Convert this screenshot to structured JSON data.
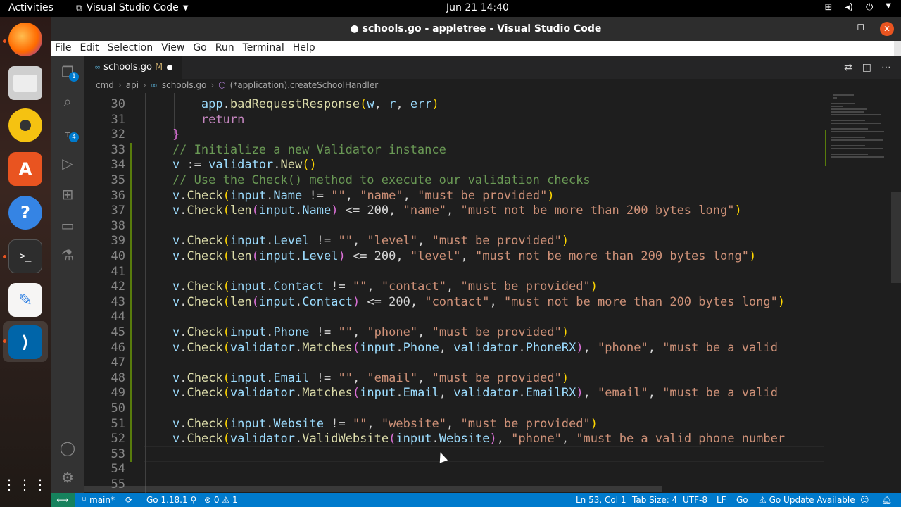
{
  "topbar": {
    "activities": "Activities",
    "app_menu": "Visual Studio Code",
    "clock": "Jun 21  14:40"
  },
  "dock": {
    "items": [
      "firefox-icon",
      "files-icon",
      "rhythmbox-icon",
      "software-icon",
      "help-icon",
      "terminal-icon",
      "text-editor-icon",
      "vscode-icon",
      "show-apps-icon"
    ]
  },
  "window": {
    "title": "● schools.go - appletree - Visual Studio Code"
  },
  "menu": [
    "File",
    "Edit",
    "Selection",
    "View",
    "Go",
    "Run",
    "Terminal",
    "Help"
  ],
  "activitybar": {
    "explorer_badge": "1",
    "scm_badge": "4"
  },
  "tab": {
    "label": "schools.go",
    "modified": "M"
  },
  "breadcrumb": [
    "cmd",
    "api",
    "schools.go",
    "(*application).createSchoolHandler"
  ],
  "editor": {
    "lines": [
      {
        "n": "30",
        "code": "        app.badRequestResponse(w, r, err)"
      },
      {
        "n": "31",
        "code": "        return"
      },
      {
        "n": "32",
        "code": "    }"
      },
      {
        "n": "33",
        "code": "    // Initialize a new Validator instance"
      },
      {
        "n": "34",
        "code": "    v := validator.New()"
      },
      {
        "n": "35",
        "code": "    // Use the Check() method to execute our validation checks"
      },
      {
        "n": "36",
        "code": "    v.Check(input.Name != \"\", \"name\", \"must be provided\")"
      },
      {
        "n": "37",
        "code": "    v.Check(len(input.Name) <= 200, \"name\", \"must not be more than 200 bytes long\")"
      },
      {
        "n": "38",
        "code": ""
      },
      {
        "n": "39",
        "code": "    v.Check(input.Level != \"\", \"level\", \"must be provided\")"
      },
      {
        "n": "40",
        "code": "    v.Check(len(input.Level) <= 200, \"level\", \"must not be more than 200 bytes long\")"
      },
      {
        "n": "41",
        "code": ""
      },
      {
        "n": "42",
        "code": "    v.Check(input.Contact != \"\", \"contact\", \"must be provided\")"
      },
      {
        "n": "43",
        "code": "    v.Check(len(input.Contact) <= 200, \"contact\", \"must not be more than 200 bytes long\")"
      },
      {
        "n": "44",
        "code": ""
      },
      {
        "n": "45",
        "code": "    v.Check(input.Phone != \"\", \"phone\", \"must be provided\")"
      },
      {
        "n": "46",
        "code": "    v.Check(validator.Matches(input.Phone, validator.PhoneRX), \"phone\", \"must be a valid"
      },
      {
        "n": "47",
        "code": ""
      },
      {
        "n": "48",
        "code": "    v.Check(input.Email != \"\", \"email\", \"must be provided\")"
      },
      {
        "n": "49",
        "code": "    v.Check(validator.Matches(input.Email, validator.EmailRX), \"email\", \"must be a valid"
      },
      {
        "n": "50",
        "code": ""
      },
      {
        "n": "51",
        "code": "    v.Check(input.Website != \"\", \"website\", \"must be provided\")"
      },
      {
        "n": "52",
        "code": "    v.Check(validator.ValidWebsite(input.Website), \"phone\", \"must be a valid phone number"
      },
      {
        "n": "53",
        "code": ""
      },
      {
        "n": "54",
        "code": ""
      },
      {
        "n": "55",
        "code": ""
      }
    ]
  },
  "status": {
    "branch": "main*",
    "go_version": "Go 1.18.1",
    "errors": "0",
    "warnings": "1",
    "position": "Ln 53, Col 1",
    "tab_size": "Tab Size: 4",
    "encoding": "UTF-8",
    "eol": "LF",
    "language": "Go",
    "update": "Go Update Available"
  },
  "colors": {
    "statusbar": "#007acc",
    "editor_bg": "#1e1e1e",
    "comment": "#6a9955",
    "string": "#ce9178",
    "function": "#dcdcaa"
  }
}
